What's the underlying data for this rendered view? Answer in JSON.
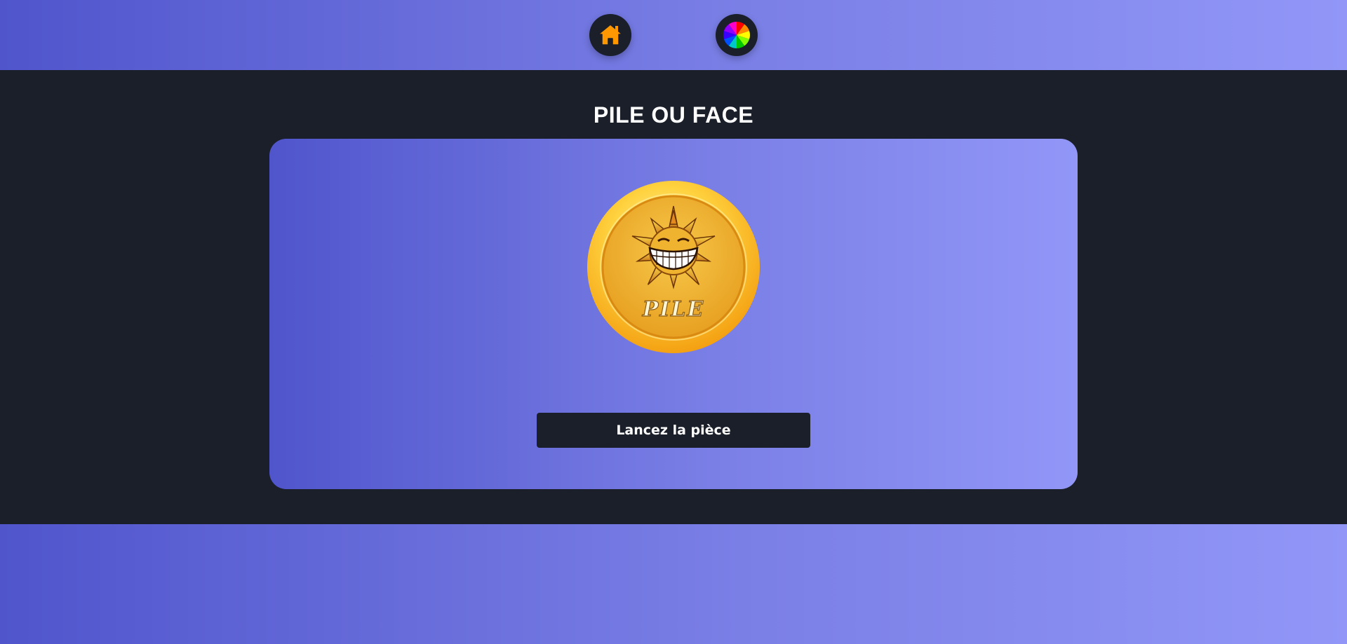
{
  "nav": {
    "home_icon": "home-icon",
    "wheel_icon": "color-wheel-icon"
  },
  "page": {
    "title": "PILE OU FACE"
  },
  "coin": {
    "face_text": "PILE",
    "icon": "grinning-sun-icon"
  },
  "actions": {
    "flip_label": "Lancez la pièce"
  },
  "colors": {
    "gradient_start": "#5055cc",
    "gradient_end": "#9196f7",
    "dark": "#1a1f2a",
    "home_icon_color": "#ff9800",
    "coin_gold": "#f7b733"
  }
}
